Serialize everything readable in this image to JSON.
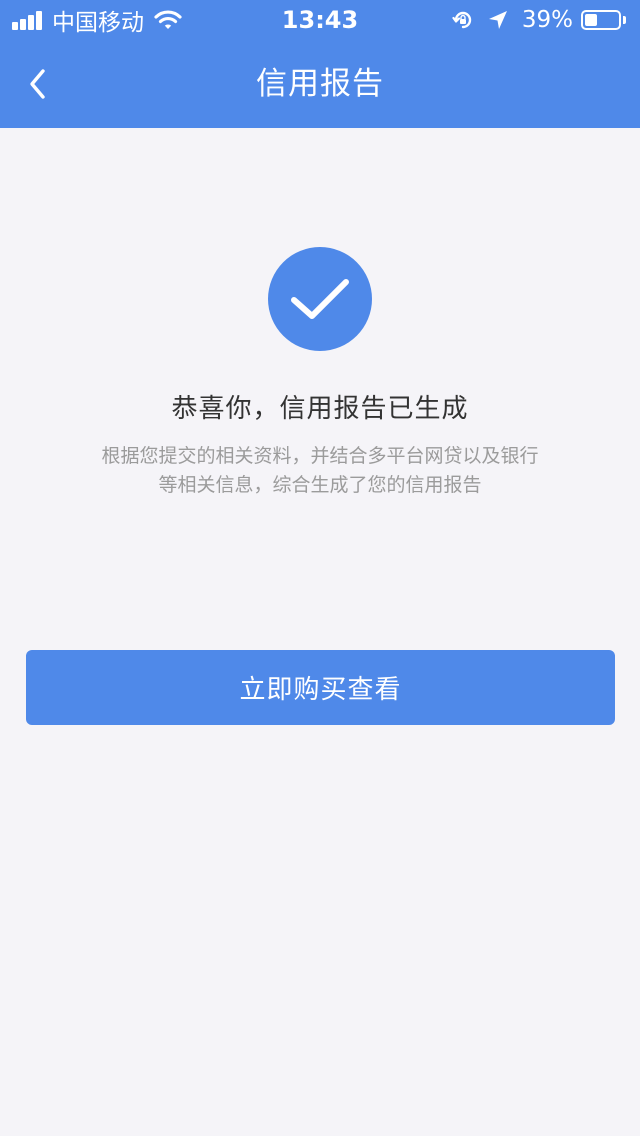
{
  "status_bar": {
    "carrier": "中国移动",
    "time": "13:43",
    "battery_percent": "39%",
    "battery_level": 0.39,
    "signal_bars": 4,
    "icons": [
      "signal-icon",
      "wifi-icon",
      "orientation-lock-icon",
      "location-arrow-icon",
      "battery-icon"
    ]
  },
  "nav": {
    "back_icon": "chevron-left-icon",
    "title": "信用报告"
  },
  "result": {
    "icon": "checkmark-icon",
    "title": "恭喜你，信用报告已生成",
    "description": "根据您提交的相关资料，并结合多平台网贷以及银行等相关信息，综合生成了您的信用报告"
  },
  "actions": {
    "buy_label": "立即购买查看"
  },
  "colors": {
    "primary": "#4f89e9",
    "background": "#f5f4f8",
    "title_text": "#333333",
    "desc_text": "#9b9b9b"
  }
}
